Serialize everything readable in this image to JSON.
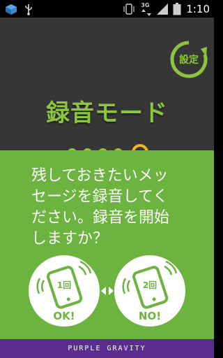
{
  "status_bar": {
    "network_type": "3G",
    "time": "1:10",
    "icons": [
      "app-notification-icon",
      "usb-icon",
      "vibrate-icon",
      "signal-icon",
      "battery-icon"
    ]
  },
  "header": {
    "settings_label": "設定",
    "mode_title": "録音モード"
  },
  "pager": {
    "total": 5,
    "active_index": 4
  },
  "prompt": {
    "lines": [
      "残しておきたいメッ",
      "セージを録音してく",
      "ださい。録音を開始",
      "しますか？"
    ]
  },
  "buttons": {
    "ok": {
      "count": "1回",
      "label": "OK!"
    },
    "no": {
      "count": "2回",
      "label": "NO!"
    }
  },
  "footer": {
    "brand": "PURPLE GRAVITY"
  },
  "colors": {
    "accent_green": "#8cc63f",
    "panel_green": "#6db33f",
    "dark_bg": "#363636",
    "active_dot": "#f2b51e",
    "footer_purple": "#5c2d91"
  }
}
